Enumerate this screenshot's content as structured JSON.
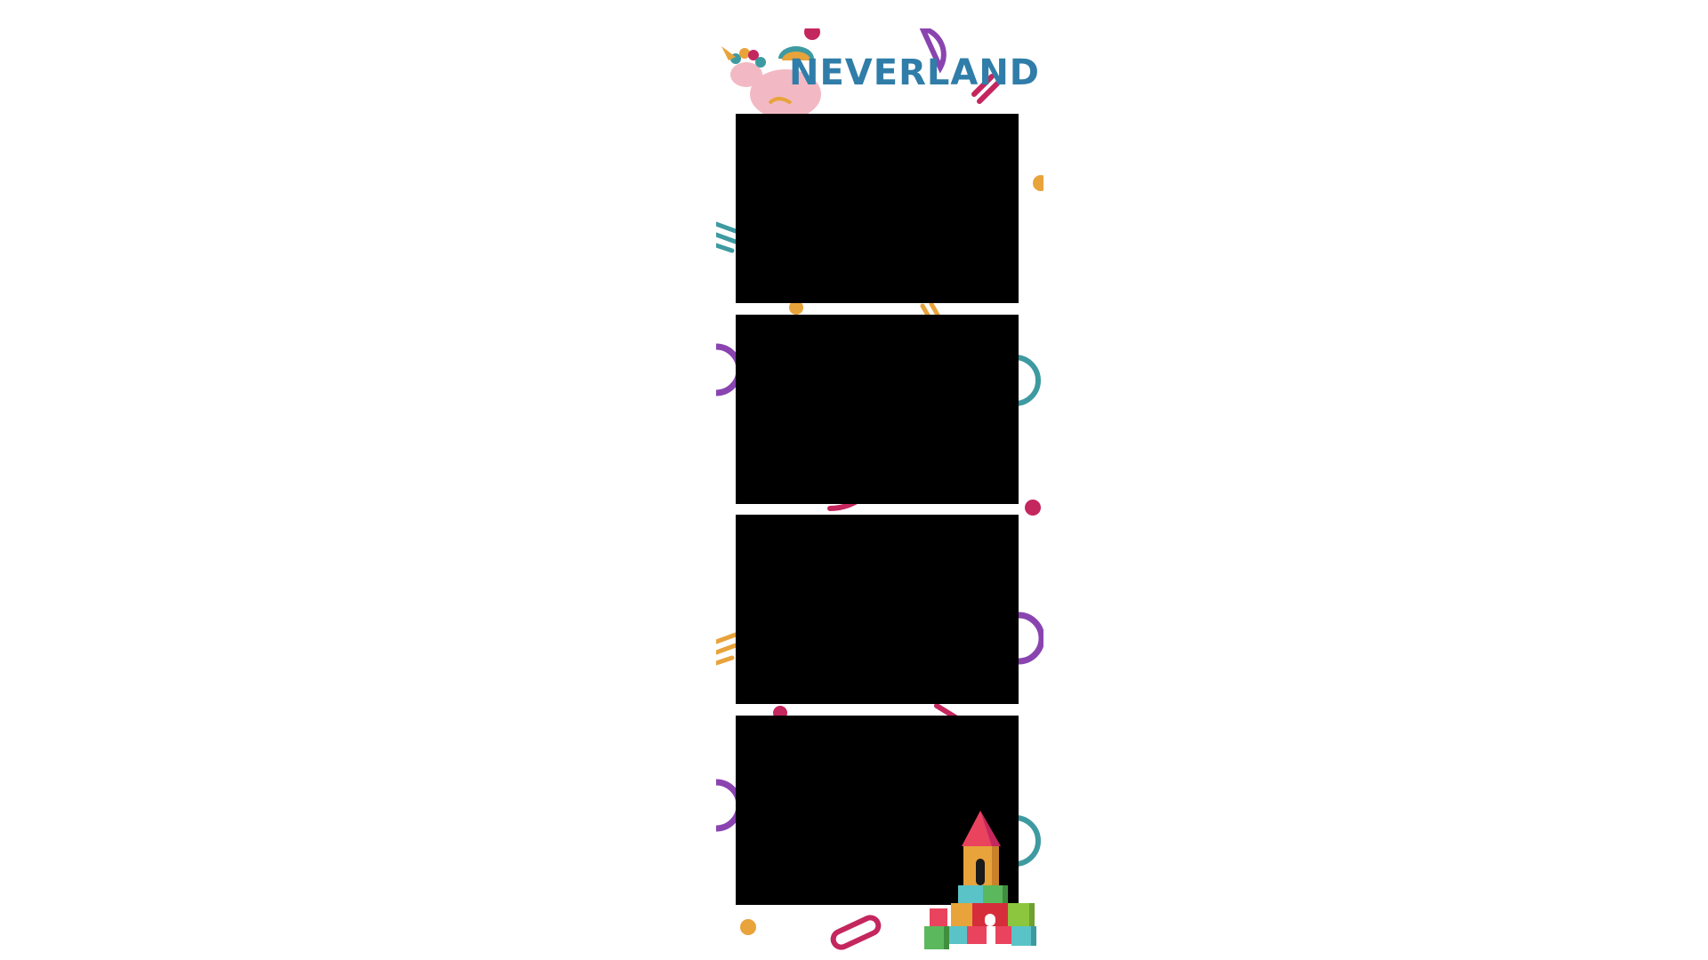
{
  "brand": {
    "title": "NEVERLAND",
    "title_color": "#2f7da8"
  },
  "photo_slots": [
    {
      "name": "photo-slot-1"
    },
    {
      "name": "photo-slot-2"
    },
    {
      "name": "photo-slot-3"
    },
    {
      "name": "photo-slot-4"
    }
  ],
  "colors": {
    "purple": "#8a44b0",
    "teal": "#3e9aa1",
    "magenta": "#c4265e",
    "orange": "#e8a33a",
    "pink": "#f2b9c4"
  },
  "icons": [
    "unicorn-icon",
    "toy-blocks-icon"
  ]
}
